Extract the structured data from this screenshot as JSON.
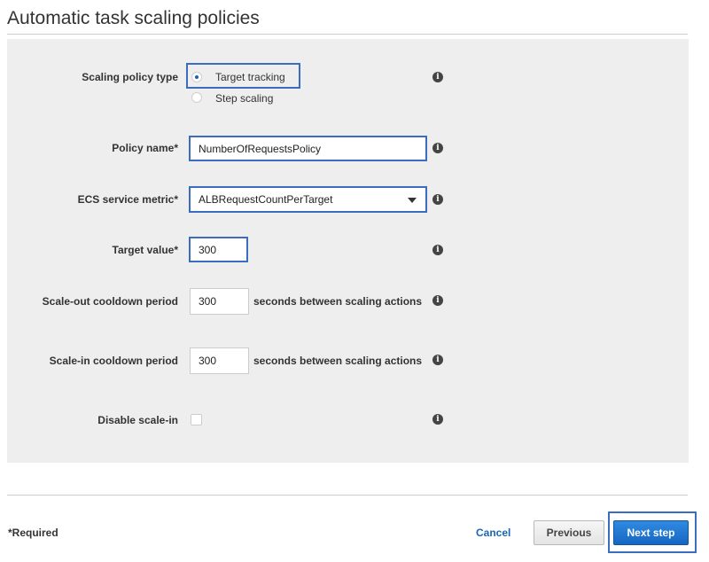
{
  "header": {
    "title": "Automatic task scaling policies"
  },
  "form": {
    "scaling_policy_type": {
      "label": "Scaling policy type",
      "options": [
        {
          "label": "Target tracking",
          "selected": true
        },
        {
          "label": "Step scaling",
          "selected": false
        }
      ]
    },
    "policy_name": {
      "label": "Policy name*",
      "value": "NumberOfRequestsPolicy"
    },
    "ecs_service_metric": {
      "label": "ECS service metric*",
      "value": "ALBRequestCountPerTarget"
    },
    "target_value": {
      "label": "Target value*",
      "value": "300"
    },
    "scale_out_cooldown": {
      "label": "Scale-out cooldown period",
      "value": "300",
      "suffix": "seconds between scaling actions"
    },
    "scale_in_cooldown": {
      "label": "Scale-in cooldown period",
      "value": "300",
      "suffix": "seconds between scaling actions"
    },
    "disable_scale_in": {
      "label": "Disable scale-in",
      "checked": false
    }
  },
  "footer": {
    "required_note": "*Required",
    "cancel_label": "Cancel",
    "previous_label": "Previous",
    "next_label": "Next step"
  },
  "icons": {
    "info": "info-icon",
    "info_glyph": "i",
    "dropdown": "chevron-down-icon"
  },
  "colors": {
    "highlight": "#3a6cc0",
    "primary_button": "#1f74d0",
    "link": "#1a66b3",
    "panel_background": "#eeeeee"
  }
}
